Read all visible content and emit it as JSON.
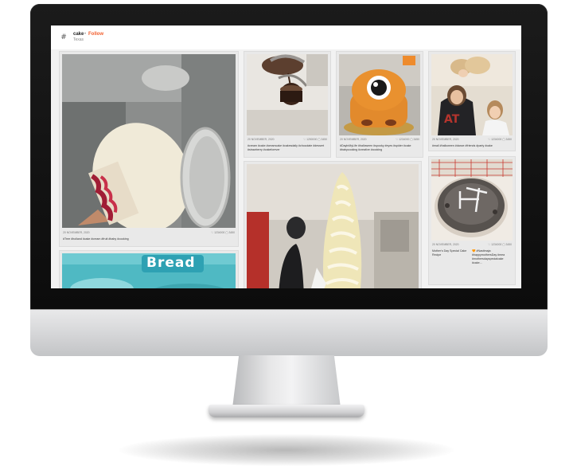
{
  "header": {
    "tag": "cake",
    "separator": "•",
    "follow_label": "Follow",
    "location": "Texas"
  },
  "posts": [
    {
      "date": "20 NOVEMBER, 2020",
      "likes": "♡ 1234000",
      "comments": "▢ 3450",
      "caption": "#Tree #holland #cake #cream #fruit #baby #cooking"
    },
    {
      "date": "20 NOVEMBER, 2020",
      "likes": "♡ 1250000",
      "comments": "▢ 3450",
      "caption": "#cream #cake #creamcake #cakesdaily #chocolate #dessert #strawberry #cakeforever"
    },
    {
      "date": "20 NOVEMBER, 2020",
      "likes": "♡ 1234000",
      "comments": "▢ 3450",
      "caption": "#DayInMyLife #halloween #spooky #eyes #spider #cake #babycooking #creative #cooking"
    },
    {
      "date": "20 NOVEMBER, 2020",
      "likes": "♡ 1234000",
      "comments": "▢ 3450",
      "caption": "#mail #halloween #dance #friends #party #cake"
    },
    {
      "date": "20 NOVEMBER, 2020",
      "likes": "♡ 1234000",
      "comments": "▢ 3450",
      "caption": "Mother's Day Special Cake Recipe",
      "caption2": "🧡 #Nastimaja #happymothersDay #mea #mothersdayspecialcake #cake..."
    }
  ],
  "bread_word": "Bread",
  "colors": {
    "accent": "#f25d2c",
    "bezel": "#111111",
    "chin": "#d4d5d7"
  }
}
